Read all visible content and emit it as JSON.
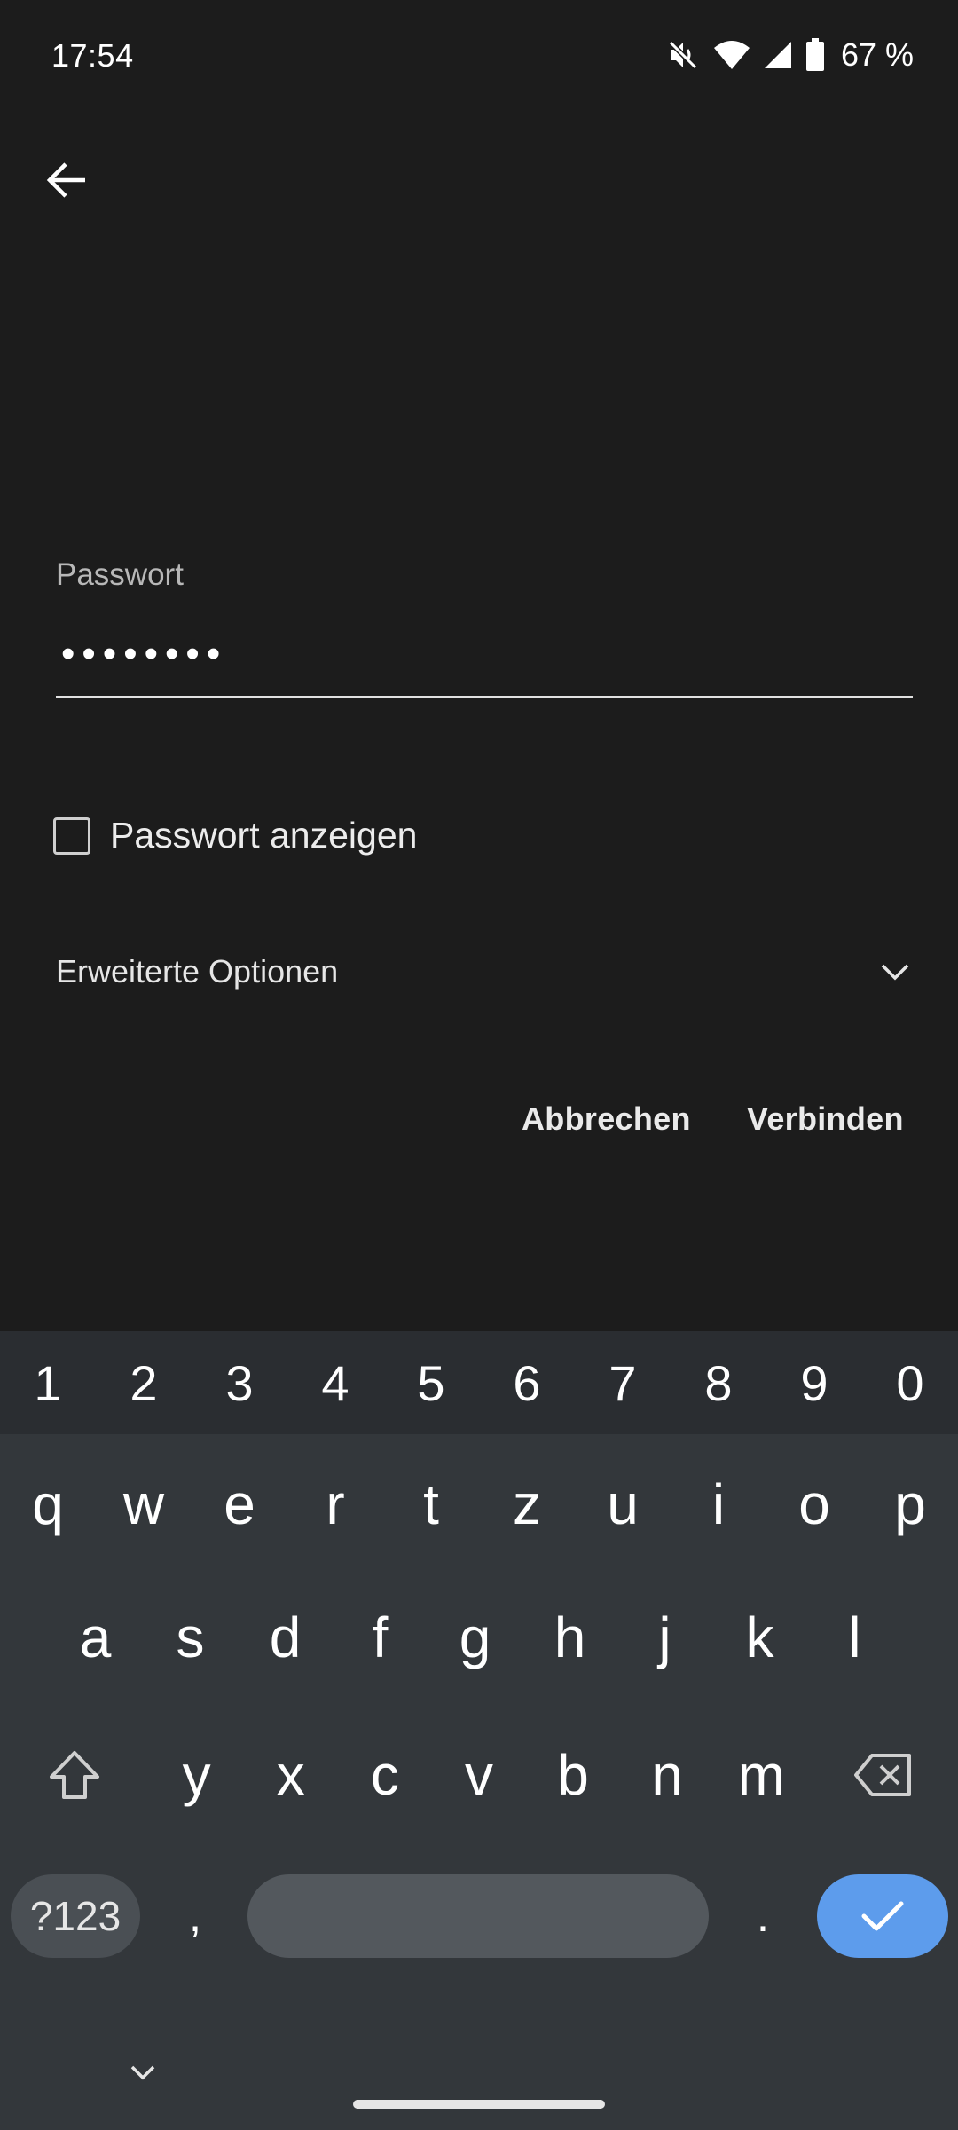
{
  "status_bar": {
    "time": "17:54",
    "battery_percent": "67 %",
    "icons": [
      "vibrate-off-icon",
      "wifi-icon",
      "signal-icon",
      "battery-icon"
    ]
  },
  "form": {
    "password_label": "Passwort",
    "password_value": "••••••••",
    "show_password_label": "Passwort anzeigen",
    "show_password_checked": false,
    "advanced_options_label": "Erweiterte Optionen",
    "cancel_label": "Abbrechen",
    "connect_label": "Verbinden"
  },
  "keyboard": {
    "numbers": [
      "1",
      "2",
      "3",
      "4",
      "5",
      "6",
      "7",
      "8",
      "9",
      "0"
    ],
    "row1": [
      "q",
      "w",
      "e",
      "r",
      "t",
      "z",
      "u",
      "i",
      "o",
      "p"
    ],
    "row2": [
      "a",
      "s",
      "d",
      "f",
      "g",
      "h",
      "j",
      "k",
      "l"
    ],
    "row3": [
      "y",
      "x",
      "c",
      "v",
      "b",
      "n",
      "m"
    ],
    "symbols_label": "?123",
    "comma": ",",
    "period": "."
  },
  "colors": {
    "background": "#1c1c1c",
    "keyboard_bg": "#33373b",
    "enter_key": "#5d9cec"
  }
}
